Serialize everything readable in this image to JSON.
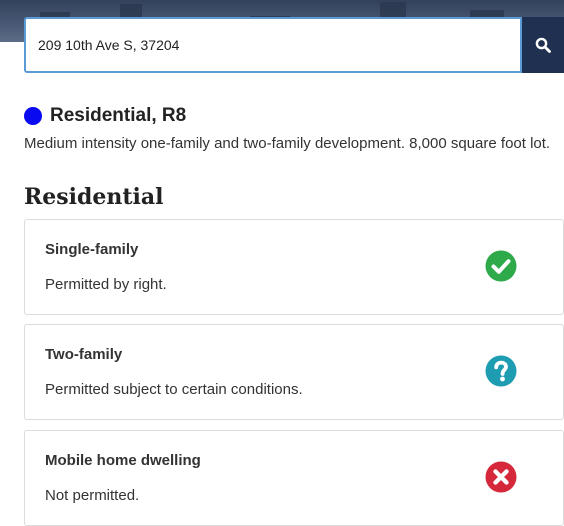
{
  "search": {
    "value": "209 10th Ave S, 37204"
  },
  "zone": {
    "title": "Residential, R8",
    "color": "#0a0af0",
    "description": "Medium intensity one-family and two-family development. 8,000 square foot lot."
  },
  "section": {
    "title": "Residential"
  },
  "uses": [
    {
      "title": "Single-family",
      "description": "Permitted by right.",
      "status": "permitted",
      "icon": "check-circle-icon",
      "color": "#2eaa4a"
    },
    {
      "title": "Two-family",
      "description": "Permitted subject to certain conditions.",
      "status": "conditional",
      "icon": "question-circle-icon",
      "color": "#1e9cb2"
    },
    {
      "title": "Mobile home dwelling",
      "description": "Not permitted.",
      "status": "not-permitted",
      "icon": "x-circle-icon",
      "color": "#d6283b"
    }
  ]
}
